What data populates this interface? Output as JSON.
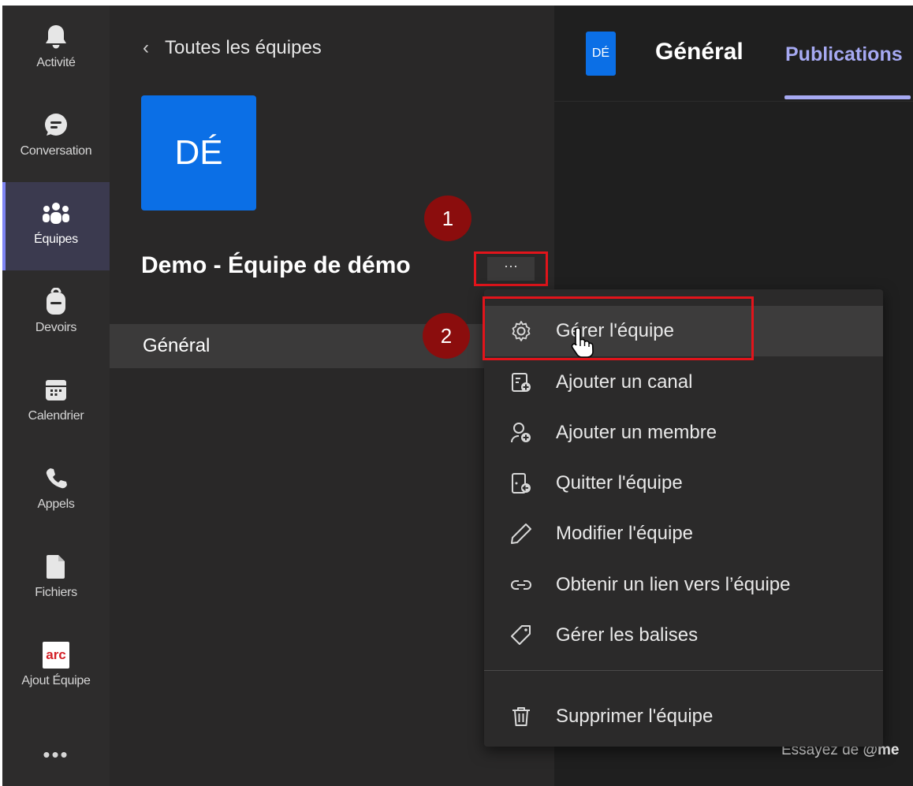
{
  "rail": {
    "items": [
      {
        "label": "Activité",
        "icon": "bell-icon"
      },
      {
        "label": "Conversation",
        "icon": "chat-icon"
      },
      {
        "label": "Équipes",
        "icon": "teams-icon"
      },
      {
        "label": "Devoirs",
        "icon": "backpack-icon"
      },
      {
        "label": "Calendrier",
        "icon": "calendar-icon"
      },
      {
        "label": "Appels",
        "icon": "phone-icon"
      },
      {
        "label": "Fichiers",
        "icon": "file-icon"
      },
      {
        "label": "Ajout Équipe",
        "icon": "arc-app-icon",
        "logo_text": "arc"
      }
    ],
    "more": "•••"
  },
  "panel": {
    "back_label": "Toutes les équipes",
    "team_initials": "DÉ",
    "team_name": "Demo - Équipe de démo",
    "more_options": "···",
    "channel": "Général"
  },
  "header": {
    "channel_initials": "DÉ",
    "channel_title": "Général",
    "tab_label": "Publications"
  },
  "compose_hint": {
    "prefix": "Essayez de ",
    "at": "@me"
  },
  "menu": {
    "items": [
      {
        "label": "Gérer l'équipe",
        "icon": "gear-icon"
      },
      {
        "label": "Ajouter un canal",
        "icon": "add-channel-icon"
      },
      {
        "label": "Ajouter un membre",
        "icon": "add-member-icon"
      },
      {
        "label": "Quitter l'équipe",
        "icon": "leave-team-icon"
      },
      {
        "label": "Modifier l'équipe",
        "icon": "pencil-icon"
      },
      {
        "label": "Obtenir un lien vers l’équipe",
        "icon": "link-icon"
      },
      {
        "label": "Gérer les balises",
        "icon": "tag-icon"
      },
      {
        "label": "Supprimer l'équipe",
        "icon": "trash-icon"
      }
    ]
  },
  "annotations": {
    "step1": "1",
    "step2": "2"
  },
  "colors": {
    "accent": "#7f85f5",
    "tab_accent": "#a6a9f2",
    "avatar_blue": "#0b6fe6",
    "highlight_red": "#e2141b",
    "badge_red": "#8b0d0d"
  }
}
